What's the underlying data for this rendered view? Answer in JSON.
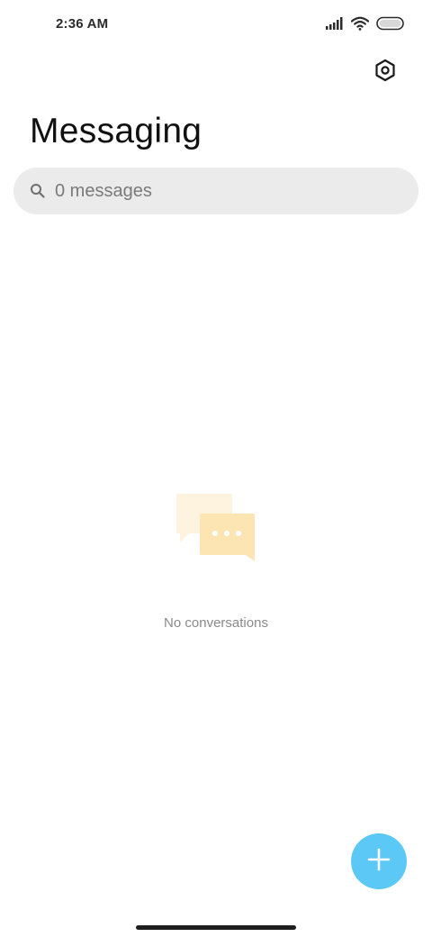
{
  "status_bar": {
    "time": "2:36 AM",
    "icons": [
      "signal-icon",
      "wifi-icon",
      "battery-icon"
    ]
  },
  "header": {
    "title": "Messaging",
    "settings_icon": "settings-icon"
  },
  "search": {
    "text": "0 messages",
    "icon": "search-icon"
  },
  "empty_state": {
    "message": "No conversations",
    "illustration": "chat-bubbles-icon"
  },
  "fab": {
    "icon": "plus-icon"
  },
  "colors": {
    "accent": "#5cc8f6",
    "search_background": "#ebebeb",
    "illustration_light": "#fdf3df",
    "illustration_main": "#fde4b3"
  }
}
